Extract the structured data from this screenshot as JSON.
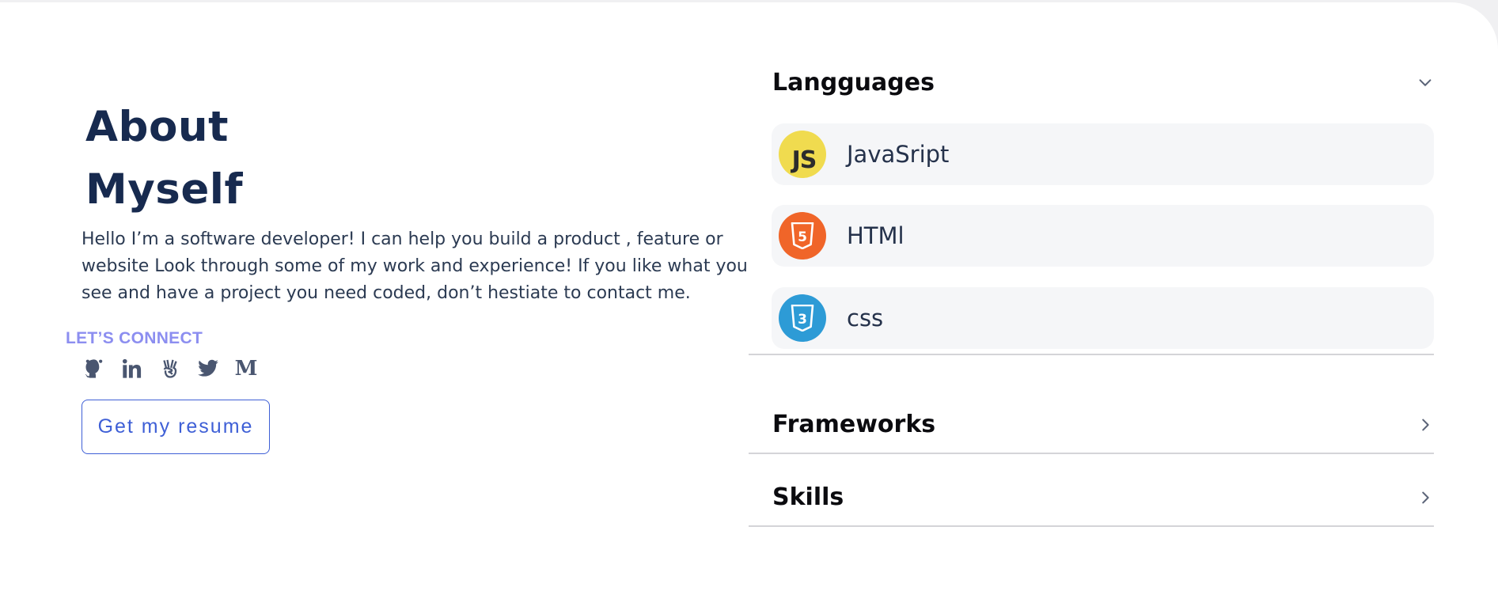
{
  "about": {
    "title_line1": "About",
    "title_line2": "Myself",
    "bio": "Hello I’m a software developer! I can help you build a product , feature or website Look through some of my work and experience! If you like what you see and have a project you need coded, don’t hestiate to contact me.",
    "connect_label": "LET’S CONNECT",
    "socials": [
      {
        "name": "github",
        "icon": "github-icon"
      },
      {
        "name": "linkedin",
        "icon": "linkedin-icon"
      },
      {
        "name": "angellist",
        "icon": "angellist-icon"
      },
      {
        "name": "twitter",
        "icon": "twitter-icon"
      },
      {
        "name": "medium",
        "icon": "medium-icon",
        "glyph": "M"
      }
    ],
    "resume_button": "Get my resume"
  },
  "skills_panel": {
    "sections": [
      {
        "title": "Langguages",
        "expanded": true,
        "items": [
          {
            "label": "JavaSript",
            "icon": "javascript-icon",
            "icon_text": "JS",
            "color": "#f0db4f"
          },
          {
            "label": "HTMl",
            "icon": "html5-icon",
            "icon_text": "5",
            "color": "#f06529"
          },
          {
            "label": "css",
            "icon": "css3-icon",
            "icon_text": "3",
            "color": "#2d9bd6"
          }
        ]
      },
      {
        "title": "Frameworks",
        "expanded": false
      },
      {
        "title": "Skills",
        "expanded": false
      }
    ]
  },
  "colors": {
    "heading": "#172a4f",
    "accent": "#3e5fd6",
    "connect": "#8c8ef0",
    "item_bg": "#f5f6f8"
  }
}
